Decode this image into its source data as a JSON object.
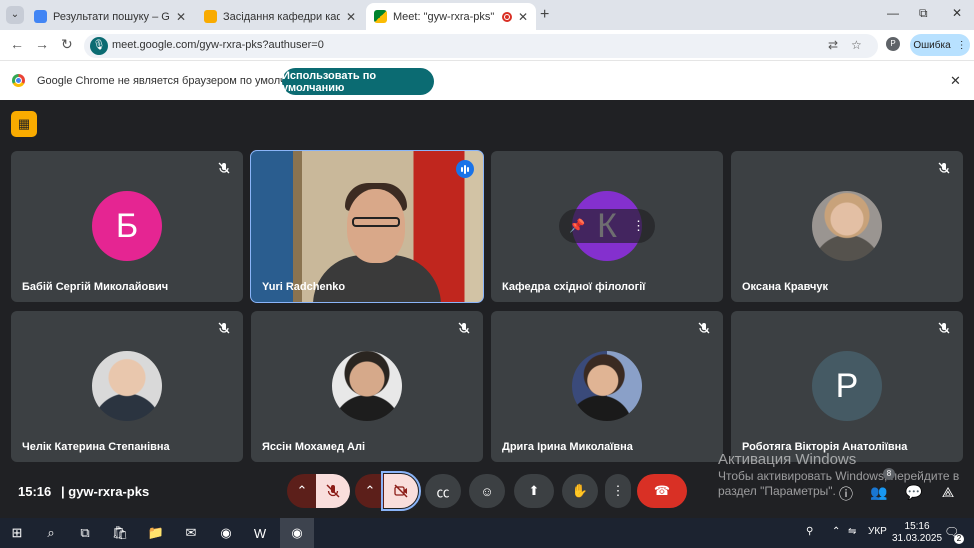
{
  "browser": {
    "tabs": [
      {
        "title": "Результати пошуку – Google Д",
        "favicon_color": "#4285f4"
      },
      {
        "title": "Засідання кафедри кафедра сх",
        "favicon_color": "#f9ab00"
      },
      {
        "title": "Meet: \"gyw-rxra-pks\"",
        "favicon_color": "#00832d"
      }
    ],
    "new_tab": "+",
    "window_controls": {
      "minimize": "—",
      "restore": "⧉",
      "close": "✕"
    },
    "url": "meet.google.com/gyw-rxra-pks?authuser=0",
    "profile_initial": "P",
    "error_button": "Ошибка"
  },
  "infobar": {
    "message": "Google Chrome не является браузером по умолчанию.",
    "button": "Использовать по умолчанию",
    "close": "✕"
  },
  "meet": {
    "participants": [
      {
        "name": "Бабій Сергій Миколайович",
        "initial": "Б",
        "avatar_color": "#e52592",
        "muted": true
      },
      {
        "name": "Yuri Radchenko",
        "video": true,
        "speaking": true
      },
      {
        "name": "Кафедра східної філології",
        "initial": "К",
        "avatar_color": "#8430ce",
        "muted": true,
        "hover_controls": true
      },
      {
        "name": "Оксана Кравчук",
        "photo": true,
        "muted": true
      },
      {
        "name": "Челік Катерина Степанівна",
        "photo": true,
        "muted": true
      },
      {
        "name": "Яссін Мохамед Алі",
        "photo": true,
        "muted": true
      },
      {
        "name": "Дрига Ірина Миколаївна",
        "photo": true,
        "muted": true
      },
      {
        "name": "Роботяга Вікторія Анатоліївна",
        "initial": "P",
        "avatar_color": "#455a64",
        "muted": true
      }
    ],
    "clock": "15:16",
    "meeting_code": "gyw-rxra-pks",
    "participant_badge": "8"
  },
  "watermark": {
    "title": "Активация Windows",
    "line1": "Чтобы активировать Windows, перейдите в",
    "line2": "раздел \"Параметры\"."
  },
  "taskbar": {
    "lang": "УКР",
    "time": "15:16",
    "date": "31.03.2025",
    "notifications": "2"
  }
}
